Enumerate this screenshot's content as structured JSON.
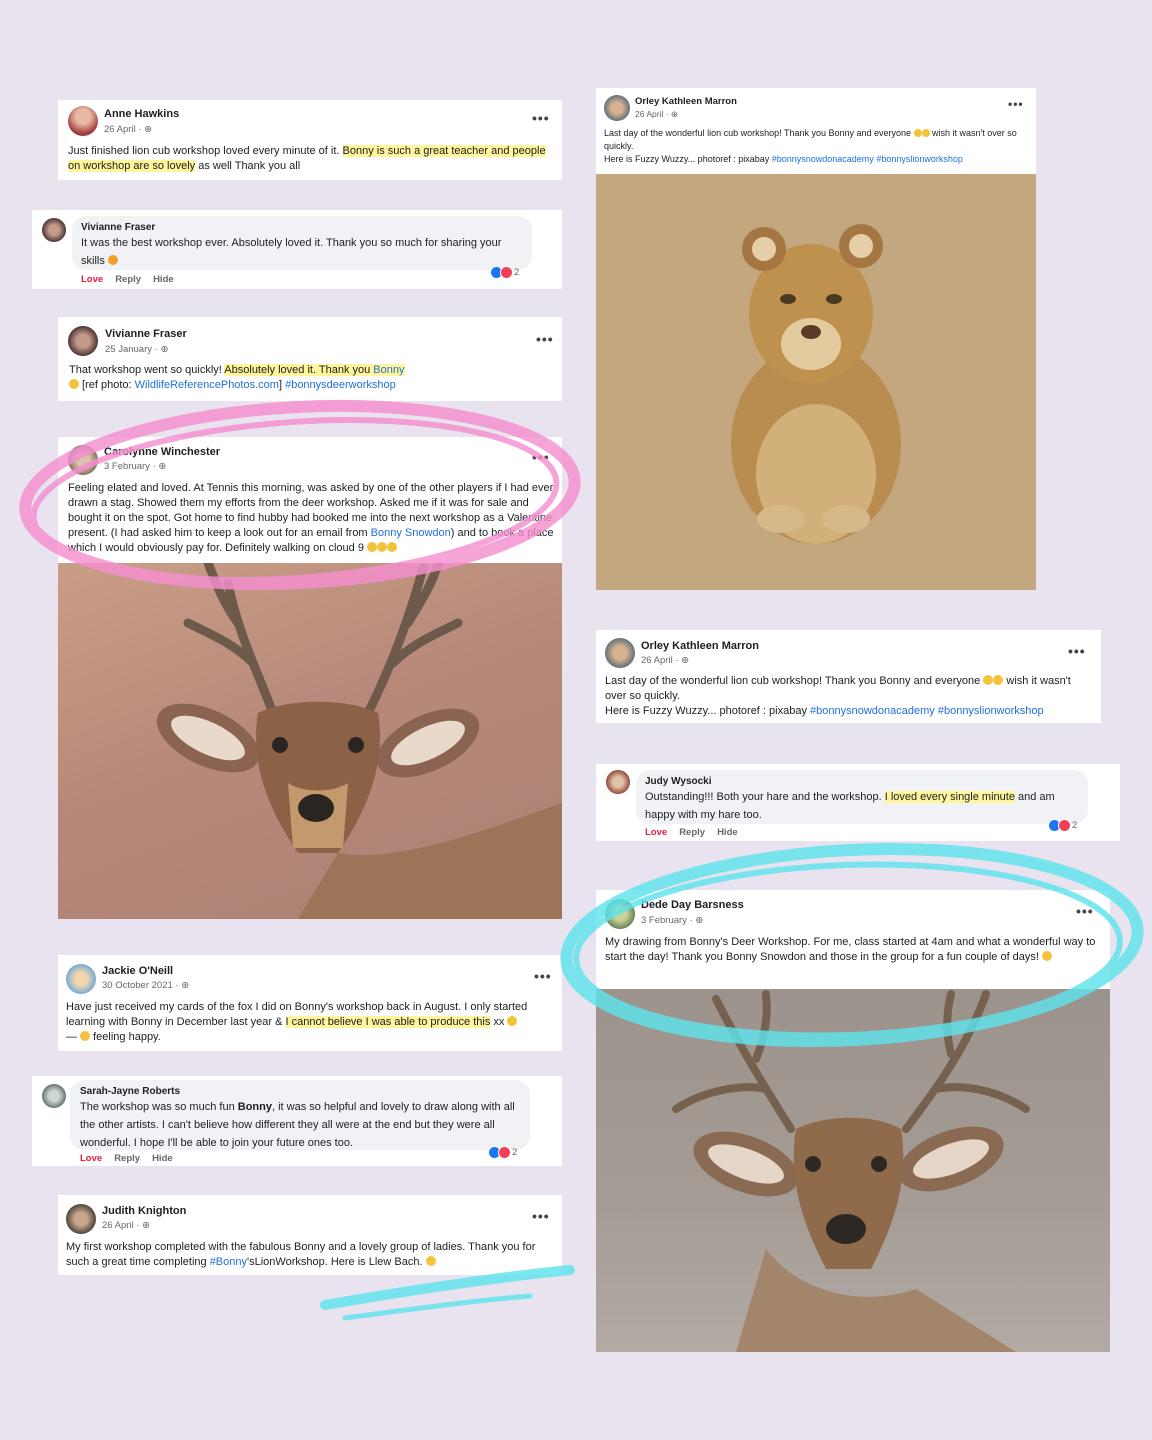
{
  "posts": {
    "anne": {
      "name": "Anne Hawkins",
      "date": "26 April",
      "text_a": "Just finished lion cub workshop loved every minute of it. ",
      "text_hl": "Bonny is such a great teacher and people on workshop are so lovely",
      "text_b": " as well Thank you all"
    },
    "viv_comment": {
      "name": "Vivianne Fraser",
      "text": "It was the best workshop ever. Absolutely loved it. Thank you so much for sharing your skills",
      "reactions": "2"
    },
    "viv_post": {
      "name": "Vivianne Fraser",
      "date": "25 January",
      "text_a": "That workshop went so quickly! ",
      "text_hl": "Absolutely loved it. Thank you ",
      "hl_link": "Bonny",
      "text_b": " [ref photo: ",
      "link1": "WildlifeReferencePhotos.com",
      "text_c": "] ",
      "link2": "#bonnysdeerworkshop"
    },
    "carolynne": {
      "name": "Carolynne Winchester",
      "date": "3 February",
      "text_a": "Feeling elated and loved. At Tennis this morning, was asked by one of the other players if I had ever drawn a stag. Showed them my efforts from the deer workshop. Asked me if it was for sale and bought it on the spot. Got home to find hubby had booked me into the next workshop as a Valentine present. (I had asked him to keep a look out for an email from ",
      "link": "Bonny Snowdon",
      "text_b": ") and to book a place which I would obviously pay for.   Definitely walking on cloud 9"
    },
    "jackie": {
      "name": "Jackie O'Neill",
      "date": "30 October 2021",
      "text_a": "Have just received my cards of the fox I did on Bonny's workshop back in August. I only started learning with Bonny in December last year & ",
      "text_hl": "I cannot believe I was able to produce this",
      "text_b": " xx",
      "text_c": " — ",
      "text_d": " feeling happy."
    },
    "sarah": {
      "name": "Sarah-Jayne Roberts",
      "text_a": "The workshop was so much fun ",
      "text_bold": "Bonny",
      "text_b": ", it was so helpful and lovely to draw along with all the other artists. I can't believe how different they all were at the end but they were all wonderful. I hope I'll be able to join your future ones too.",
      "reactions": "2"
    },
    "judith": {
      "name": "Judith Knighton",
      "date": "26 April",
      "text_a": "My first workshop completed with the fabulous Bonny and a lovely group of ladies.  Thank you for such a great time completing ",
      "link": "#Bonny",
      "text_b": "'sLionWorkshop.  Here is Llew Bach."
    },
    "orley_small": {
      "name": "Orley Kathleen Marron",
      "date": "26 April",
      "text_a": "Last day of the wonderful lion cub workshop! Thank you Bonny and everyone",
      "text_b": " wish it wasn't over so quickly.",
      "text_c": "Here is Fuzzy Wuzzy... photoref : pixabay ",
      "link1": "#bonnysnowdonacademy",
      "link2": "#bonnyslionworkshop"
    },
    "orley_big": {
      "name": "Orley Kathleen Marron",
      "date": "26 April",
      "text_a": "Last day of the wonderful lion cub workshop! Thank you Bonny and everyone",
      "text_b": " wish it wasn't over so quickly.",
      "text_c": "Here is Fuzzy Wuzzy... photoref : pixabay ",
      "link1": "#bonnysnowdonacademy",
      "link2": "#bonnyslionworkshop"
    },
    "judy": {
      "name": "Judy Wysocki",
      "text_a": "Outstanding!!! Both your hare and the workshop. ",
      "text_hl": "I loved every single minute",
      "text_b": " and am happy with my hare too.",
      "reactions": "2"
    },
    "dede": {
      "name": "Dede Day Barsness",
      "date": "3 February",
      "text": "My drawing from Bonny's Deer Workshop.  For me, class started at 4am and what a wonderful way to start the day!  Thank you Bonny Snowdon and those in the group for a fun couple of days!"
    }
  },
  "actions": {
    "love": "Love",
    "reply": "Reply",
    "hide": "Hide"
  },
  "more_label": "•••",
  "colors": {
    "highlight": "#fff59a",
    "link": "#216fdb",
    "pink_marker": "#f48fd0",
    "cyan_marker": "#5fe3ec",
    "love": "#e41e3f",
    "background": "#e9e3ef"
  }
}
